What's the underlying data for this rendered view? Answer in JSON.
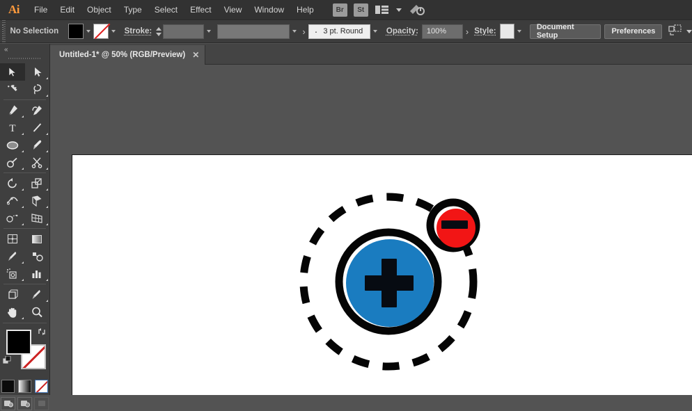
{
  "app": {
    "name": "Adobe Illustrator",
    "logo_text": "Ai"
  },
  "menubar": {
    "items": [
      {
        "label": "File"
      },
      {
        "label": "Edit"
      },
      {
        "label": "Object"
      },
      {
        "label": "Type"
      },
      {
        "label": "Select"
      },
      {
        "label": "Effect"
      },
      {
        "label": "View"
      },
      {
        "label": "Window"
      },
      {
        "label": "Help"
      }
    ],
    "bridge_label": "Br",
    "stock_label": "St",
    "arrange_tooltip": "Arrange Documents",
    "workspace_tooltip": "Workspace Switcher"
  },
  "controlbar": {
    "selection_status": "No Selection",
    "fill_color": "#000000",
    "stroke_color": "none",
    "stroke_label": "Stroke:",
    "stroke_weight": "",
    "stroke_profile": "",
    "brush_definition": "3 pt. Round",
    "opacity_label": "Opacity:",
    "opacity_value": "100%",
    "style_label": "Style:",
    "style_swatch": "#ffffff",
    "document_setup_label": "Document Setup",
    "preferences_label": "Preferences"
  },
  "tabbar": {
    "document_tab": {
      "title": "Untitled-1* @ 50% (RGB/Preview)",
      "close_label": "✕"
    }
  },
  "toolpanel": {
    "collapse_label": "«",
    "tools": [
      {
        "name": "selection-tool",
        "active": true
      },
      {
        "name": "direct-selection-tool",
        "active": false
      },
      {
        "name": "magic-wand-tool",
        "active": false
      },
      {
        "name": "lasso-tool",
        "active": false
      },
      {
        "name": "pen-tool",
        "active": false
      },
      {
        "name": "curvature-tool",
        "active": false
      },
      {
        "name": "type-tool",
        "active": false
      },
      {
        "name": "line-segment-tool",
        "active": false
      },
      {
        "name": "ellipse-tool",
        "active": false
      },
      {
        "name": "paintbrush-tool",
        "active": false
      },
      {
        "name": "shaper-tool",
        "active": false
      },
      {
        "name": "scissors-tool",
        "active": false
      },
      {
        "name": "rotate-tool",
        "active": false
      },
      {
        "name": "scale-tool",
        "active": false
      },
      {
        "name": "width-tool",
        "active": false
      },
      {
        "name": "free-transform-tool",
        "active": false
      },
      {
        "name": "shape-builder-tool",
        "active": false
      },
      {
        "name": "perspective-grid-tool",
        "active": false
      },
      {
        "name": "mesh-tool",
        "active": false
      },
      {
        "name": "gradient-tool",
        "active": false
      },
      {
        "name": "eyedropper-tool",
        "active": false
      },
      {
        "name": "blend-tool",
        "active": false
      },
      {
        "name": "symbol-sprayer-tool",
        "active": false
      },
      {
        "name": "column-graph-tool",
        "active": false
      },
      {
        "name": "artboard-tool",
        "active": false
      },
      {
        "name": "slice-tool",
        "active": false
      },
      {
        "name": "hand-tool",
        "active": false
      },
      {
        "name": "zoom-tool",
        "active": false
      }
    ],
    "fill_swatch": "#000000",
    "stroke_swatch": "none",
    "color_mode_color": "#0b0b0b",
    "color_mode_gradient": "gradient",
    "color_mode_none": "none",
    "screen_modes": [
      "normal-screen-mode",
      "full-screen-menubar",
      "full-screen"
    ]
  },
  "canvas": {
    "zoom_level": "50%",
    "artboard_background": "#ffffff",
    "workspace_background": "#535353",
    "artwork": {
      "name": "atom-illustration",
      "description": "Atom icon: blue nucleus with plus sign, red electron with minus sign on a dashed orbit",
      "nucleus_fill": "#1a7cc0",
      "nucleus_outline": "#050505",
      "nucleus_symbol": "+",
      "electron_fill": "#f21515",
      "electron_outline": "#050505",
      "electron_symbol": "−",
      "orbit_stroke": "#050505",
      "orbit_style": "dashed"
    }
  }
}
